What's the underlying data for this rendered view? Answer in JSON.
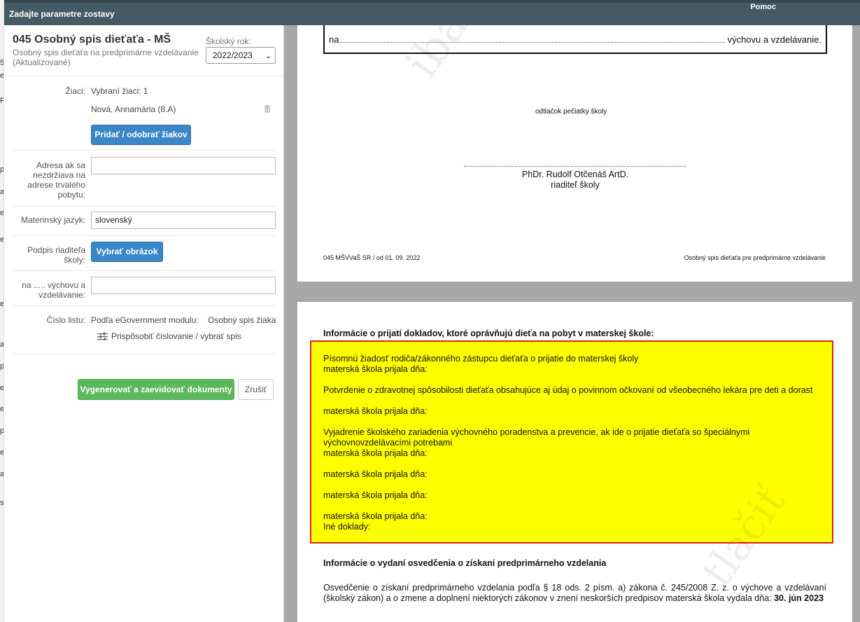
{
  "background": {
    "left_strip_letters": [
      "5",
      "e",
      "P",
      "p",
      "a",
      "e",
      "e",
      "e",
      "a",
      "p",
      "e",
      "e",
      "p",
      "e",
      "a",
      "s"
    ],
    "top_right_help": "Pomoc"
  },
  "modal": {
    "title": "Zadajte parametre zostavy"
  },
  "form": {
    "title": "045 Osobný spis dieťaťa - MŠ",
    "subtitle": "Osobný spis dieťaťa na predprimárne vzdelávanie (Aktualizované)",
    "year_label": "Školský rok:",
    "year_value": "2022/2023",
    "students_label": "Žiaci:",
    "students_count": "Vybraní žiaci: 1",
    "student_name": "Nová, Annamária (8.A)",
    "add_remove_button": "Pridať / odobrať žiakov",
    "address_label": "Adresa ak sa nezdržiava na adrese trvalého pobytu:",
    "address_value": "",
    "language_label": "Materinský jazyk:",
    "language_value": "slovenský",
    "signature_label": "Podpis riaditeľa školy:",
    "signature_button": "Vybrať obrázok",
    "education_label": "na ..... výchovu a vzdelávanie:",
    "education_value": "",
    "sheet_label": "Číslo listu:",
    "sheet_source": "Podľa eGovernment modulu:",
    "sheet_value": "Osobný spis žiaka",
    "numbering_link": "Prispôsobiť číslovanie / vybrať spis",
    "generate_button": "Vygenerovať a zaevidovať dokumenty",
    "cancel_button": "Zrušiť"
  },
  "preview": {
    "page1": {
      "na_text": "na",
      "education_text": "výchovu a vzdelávanie.",
      "stamp_text": "odtlačok pečiatky školy",
      "director_name": "PhDr. Rudolf Otčenáš ArtD.",
      "director_title": "riaditeľ školy",
      "footer_left": "045 MŠVVaŠ SR / od 01. 09. 2022",
      "footer_right": "Osobný spis dieťaťa pre predprimárne vzdelávanie"
    },
    "page2": {
      "heading1": "Informácie o prijatí dokladov, ktoré oprávňujú dieťa na pobyt v materskej škole:",
      "doc1": "Písomnú žiadosť rodiča/zákonného zástupcu dieťaťa o prijatie do materskej školy",
      "received1": "materská škola prijala dňa:",
      "doc2": "Potvrdenie o zdravotnej spôsobilosti dieťaťa obsahujúce aj údaj o povinnom očkovaní od všeobecného lekára pre deti a dorast",
      "received2": "materská škola prijala dňa:",
      "doc3": "Vyjadrenie školského zariadenia výchovného poradenstva a prevencie, ak ide o prijatie dieťaťa so špeciálnymi výchovnovzdelávacími potrebami",
      "received3": "materská škola prijala dňa:",
      "received4": "materská škola prijala dňa:",
      "received5": "materská škola prijala dňa:",
      "received6": "materská škola prijala dňa:",
      "other_docs": "Iné doklady:",
      "heading2": "Informácie o vydaní osvedčenia o získaní predprimárneho vzdelania",
      "body": "Osvedčenie o získaní predprimárneho vzdelania podľa § 18 ods. 2 písm. a) zákona č. 245/2008 Z. z. o výchove a vzdelávaní (školský zákon) a o zmene a doplnení niektorých zákonov v znení neskorších predpisov materská škola vydala dňa: ",
      "issue_date": "30. jún 2023"
    },
    "watermark1": "iba",
    "watermark2": "tlačiť"
  }
}
